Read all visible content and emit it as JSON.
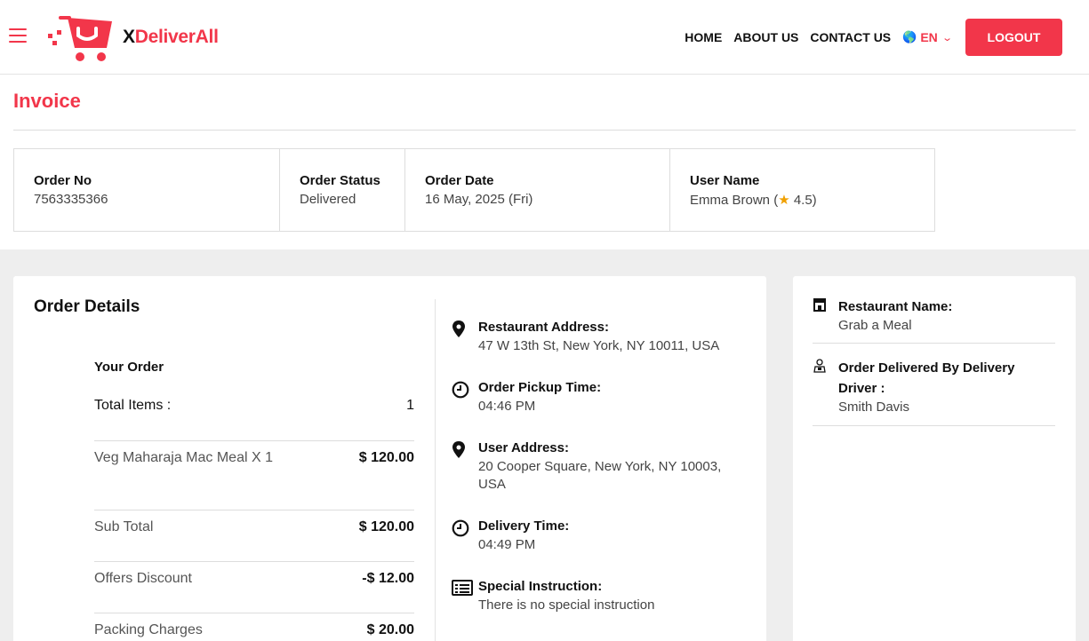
{
  "header": {
    "brand_x": "X",
    "brand_rest": "DeliverAll",
    "nav": [
      "HOME",
      "ABOUT US",
      "CONTACT US"
    ],
    "language": "EN",
    "logout_label": "LOGOUT"
  },
  "page": {
    "title": "Invoice"
  },
  "summary": {
    "order_no_label": "Order No",
    "order_no": "7563335366",
    "status_label": "Order Status",
    "status": "Delivered",
    "date_label": "Order Date",
    "date": "16 May, 2025 (Fri)",
    "user_label": "User Name",
    "user_name": "Emma Brown (",
    "user_rating": "4.5",
    "user_suffix": ")"
  },
  "order_details": {
    "title": "Order Details",
    "your_order": "Your Order",
    "total_items_label": "Total Items :",
    "total_items": "1",
    "lines": [
      {
        "name": "Veg Maharaja Mac Meal X 1",
        "amount": "$ 120.00"
      },
      {
        "name": "Sub Total",
        "amount": "$ 120.00"
      },
      {
        "name": "Offers Discount",
        "amount": "-$ 12.00"
      },
      {
        "name": "Packing Charges",
        "amount": "$ 20.00"
      }
    ],
    "info": [
      {
        "label": "Restaurant Address:",
        "text": "47 W 13th St, New York, NY 10011, USA",
        "icon": "location-pin-icon"
      },
      {
        "label": "Order Pickup Time:",
        "text": "04:46 PM",
        "icon": "clock-icon"
      },
      {
        "label": "User Address:",
        "text": "20 Cooper Square, New York, NY 10003, USA",
        "icon": "location-pin-icon"
      },
      {
        "label": "Delivery Time:",
        "text": "04:49 PM",
        "icon": "clock-icon"
      },
      {
        "label": "Special Instruction:",
        "text": "There is no special instruction",
        "icon": "list-icon"
      }
    ]
  },
  "side": {
    "restaurant_label": "Restaurant Name:",
    "restaurant": "Grab a Meal",
    "driver_label": "Order Delivered By Delivery Driver :",
    "driver": "Smith Davis"
  },
  "colors": {
    "accent": "#f2364a",
    "band": "#eeeeee",
    "star": "#f0a000"
  }
}
